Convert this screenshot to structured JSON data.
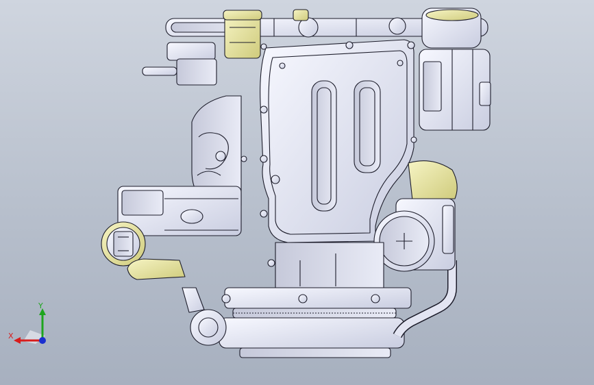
{
  "viewport": {
    "background_top": "#cfd5df",
    "background_bottom": "#a7b0bf"
  },
  "model": {
    "part_fill": "#eceef7",
    "part_shade": "#c8ccde",
    "edge_color": "#1c1c2a",
    "accent_fill": "#ece9a8"
  },
  "triad": {
    "x_label": "X",
    "y_label": "Y",
    "x_color": "#d81c1c",
    "y_color": "#1ea51e",
    "z_color": "#1a2fd0"
  }
}
